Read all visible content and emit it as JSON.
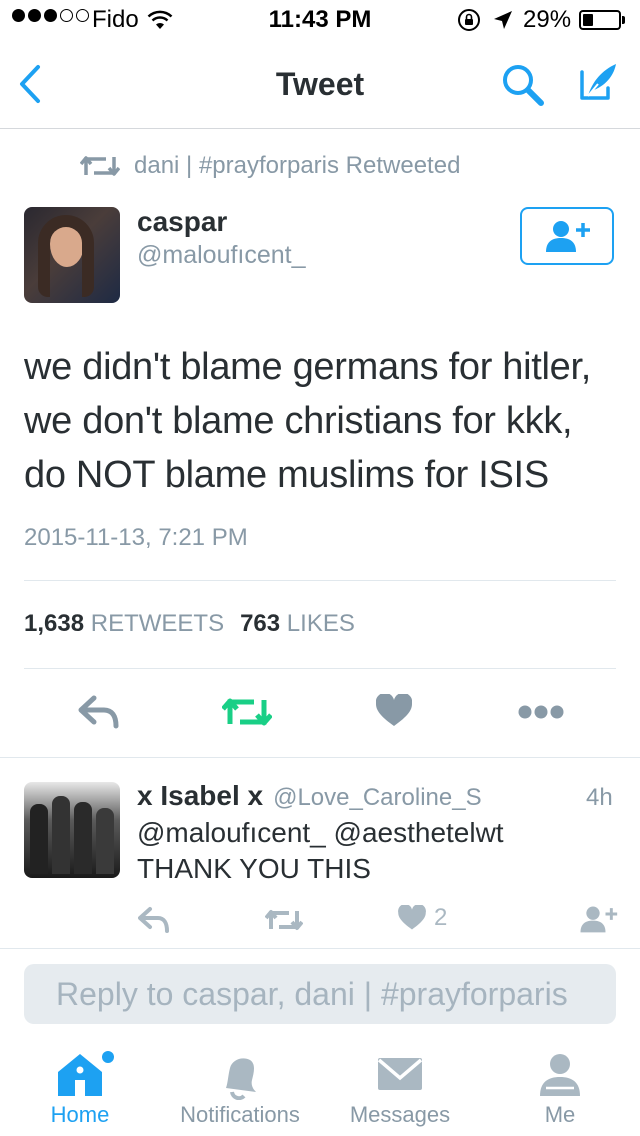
{
  "status_bar": {
    "carrier": "Fido",
    "time": "11:43 PM",
    "battery": "29%",
    "battery_level": 0.29
  },
  "nav": {
    "title": "Tweet"
  },
  "tweet": {
    "retweet_context": "dani | #prayforparis Retweeted",
    "author_name": "caspar",
    "author_handle": "@maloufıcent_",
    "lines": [
      "we didn't blame germans for hitler,",
      "we don't blame christians for kkk,",
      "do NOT blame muslims for ISIS"
    ],
    "timestamp": "2015-11-13, 7:21 PM",
    "retweets_count": "1,638",
    "retweets_label": "RETWEETS",
    "likes_count": "763",
    "likes_label": "LIKES"
  },
  "reply": {
    "name": "x Isabel x",
    "handle": "@Love_Caroline_S",
    "time": "4h",
    "line1": "@maloufıcent_ @aesthetelwt",
    "line2": "THANK YOU THIS",
    "likes": "2"
  },
  "compose": {
    "placeholder": "Reply to caspar, dani | #prayforparis"
  },
  "tabs": [
    {
      "label": "Home",
      "icon": "home-icon",
      "active": true
    },
    {
      "label": "Notifications",
      "icon": "bell-icon"
    },
    {
      "label": "Messages",
      "icon": "envelope-icon"
    },
    {
      "label": "Me",
      "icon": "person-icon"
    }
  ],
  "colors": {
    "accent": "#1da1f2",
    "retweet_green": "#19cf86",
    "muted": "#8899a6",
    "icon_gray": "#aab8c2"
  }
}
